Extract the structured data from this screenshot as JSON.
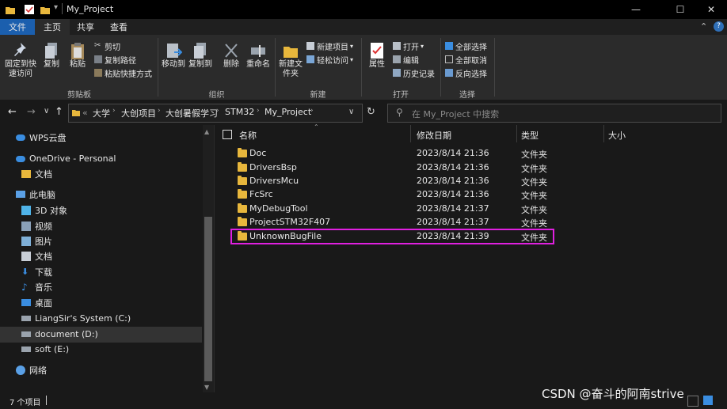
{
  "window": {
    "title": "My_Project"
  },
  "ribbon_tabs": [
    "文件",
    "主页",
    "共享",
    "查看"
  ],
  "ribbon": {
    "clipboard": {
      "pin_label": "固定到快速访问",
      "copy_label": "复制",
      "paste_label": "粘贴",
      "cut_label": "剪切",
      "copy_path_label": "复制路径",
      "paste_shortcut_label": "粘贴快捷方式",
      "group_label": "剪贴板"
    },
    "organize": {
      "move_to_label": "移动到",
      "copy_to_label": "复制到",
      "delete_label": "删除",
      "rename_label": "重命名",
      "group_label": "组织"
    },
    "new": {
      "new_folder_label": "新建文件夹",
      "new_item_label": "新建项目",
      "easy_access_label": "轻松访问",
      "group_label": "新建"
    },
    "open": {
      "properties_label": "属性",
      "open_label": "打开",
      "edit_label": "编辑",
      "history_label": "历史记录",
      "group_label": "打开"
    },
    "select": {
      "select_all_label": "全部选择",
      "select_none_label": "全部取消",
      "invert_label": "反向选择",
      "group_label": "选择"
    }
  },
  "address": {
    "prefix": "«",
    "breadcrumb": [
      "大学",
      "大创项目",
      "大创暑假学习",
      "STM32",
      "My_Project"
    ],
    "search_placeholder": "在 My_Project 中搜索"
  },
  "nav_pane": {
    "items": [
      {
        "label": "WPS云盘",
        "icon": "cloud-icon"
      },
      {
        "label": "OneDrive - Personal",
        "icon": "cloud-icon"
      },
      {
        "label": "文档",
        "icon": "folder-icon"
      },
      {
        "label": "此电脑",
        "icon": "computer-icon"
      },
      {
        "label": "3D 对象",
        "icon": "cube-icon"
      },
      {
        "label": "视频",
        "icon": "video-icon"
      },
      {
        "label": "图片",
        "icon": "picture-icon"
      },
      {
        "label": "文档",
        "icon": "document-icon"
      },
      {
        "label": "下载",
        "icon": "download-icon"
      },
      {
        "label": "音乐",
        "icon": "music-icon"
      },
      {
        "label": "桌面",
        "icon": "desktop-icon"
      },
      {
        "label": "LiangSir's System (C:)",
        "icon": "drive-icon"
      },
      {
        "label": "document (D:)",
        "icon": "drive-icon"
      },
      {
        "label": "soft (E:)",
        "icon": "drive-icon"
      },
      {
        "label": "网络",
        "icon": "network-icon"
      }
    ]
  },
  "file_list": {
    "columns": [
      "名称",
      "修改日期",
      "类型",
      "大小"
    ],
    "rows": [
      {
        "name": "Doc",
        "date": "2023/8/14 21:36",
        "type": "文件夹"
      },
      {
        "name": "DriversBsp",
        "date": "2023/8/14 21:36",
        "type": "文件夹"
      },
      {
        "name": "DriversMcu",
        "date": "2023/8/14 21:36",
        "type": "文件夹"
      },
      {
        "name": "FcSrc",
        "date": "2023/8/14 21:36",
        "type": "文件夹"
      },
      {
        "name": "MyDebugTool",
        "date": "2023/8/14 21:37",
        "type": "文件夹"
      },
      {
        "name": "ProjectSTM32F407",
        "date": "2023/8/14 21:37",
        "type": "文件夹"
      },
      {
        "name": "UnknownBugFile",
        "date": "2023/8/14 21:39",
        "type": "文件夹"
      }
    ],
    "highlight_color": "#e020e0"
  },
  "status": {
    "item_count": "7 个项目"
  },
  "watermark": "CSDN @奋斗的阿南strive",
  "colors": {
    "accent": "#2f6fb7",
    "folder": "#e8b73c",
    "selected_nav": "#333333"
  }
}
